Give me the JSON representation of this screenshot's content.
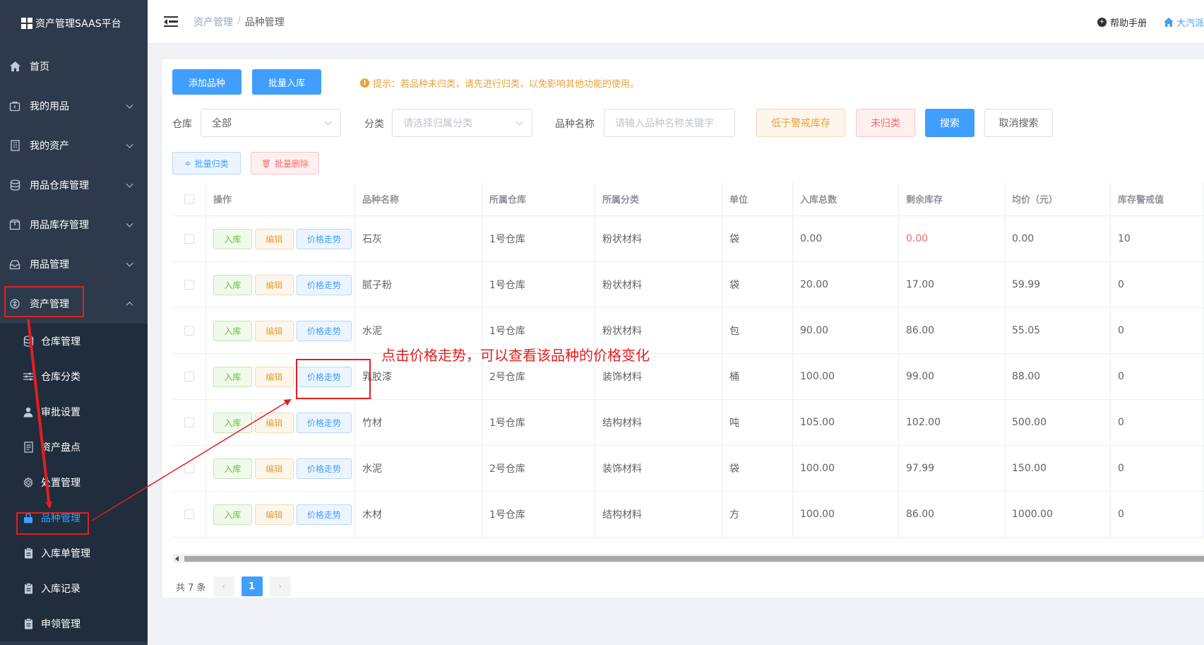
{
  "app": {
    "title": "资产管理SAAS平台"
  },
  "sidebar": {
    "items": [
      {
        "label": "首页",
        "icon": "home-icon"
      },
      {
        "label": "我的用品",
        "icon": "bag-icon"
      },
      {
        "label": "我的资产",
        "icon": "building-icon"
      },
      {
        "label": "用品仓库管理",
        "icon": "database-icon"
      },
      {
        "label": "用品库存管理",
        "icon": "box-icon"
      },
      {
        "label": "用品管理",
        "icon": "inbox-icon"
      },
      {
        "label": "资产管理",
        "icon": "asset-icon"
      }
    ],
    "sub_items": [
      {
        "label": "仓库管理",
        "icon": "database-icon"
      },
      {
        "label": "仓库分类",
        "icon": "sliders-icon"
      },
      {
        "label": "审批设置",
        "icon": "user-icon"
      },
      {
        "label": "资产盘点",
        "icon": "document-icon"
      },
      {
        "label": "处置管理",
        "icon": "gear-icon"
      },
      {
        "label": "品种管理",
        "icon": "lock-icon"
      },
      {
        "label": "入库单管理",
        "icon": "clipboard-icon"
      },
      {
        "label": "入库记录",
        "icon": "clipboard-icon"
      },
      {
        "label": "申领管理",
        "icon": "clipboard-icon"
      }
    ]
  },
  "topbar": {
    "breadcrumb": [
      "资产管理",
      "品种管理"
    ],
    "help": "帮助手册",
    "user": "大汽派"
  },
  "toolbar": {
    "add_label": "添加品种",
    "batch_in_label": "批量入库",
    "tip": "提示：若品种未归类，请先进行归类，以免影响其他功能的使用。",
    "warehouse_label": "仓库",
    "warehouse_value": "全部",
    "category_label": "分类",
    "category_placeholder": "请选择归属分类",
    "name_label": "品种名称",
    "name_placeholder": "请输入品种名称关键字",
    "low_stock_label": "低于警戒库存",
    "unclassified_label": "未归类",
    "search_label": "搜索",
    "cancel_search_label": "取消搜索",
    "batch_classify_label": "批量归类",
    "batch_delete_label": "批量删除"
  },
  "table": {
    "headers": [
      "操作",
      "品种名称",
      "所属仓库",
      "所属分类",
      "单位",
      "入库总数",
      "剩余库存",
      "均价（元）",
      "库存警戒值"
    ],
    "op_labels": {
      "in": "入库",
      "edit": "编辑",
      "price": "价格走势"
    },
    "rows": [
      {
        "name": "石灰",
        "warehouse": "1号仓库",
        "category": "粉状材料",
        "unit": "袋",
        "total": "0.00",
        "remaining": "0.00",
        "avg": "0.00",
        "alert": "10"
      },
      {
        "name": "腻子粉",
        "warehouse": "1号仓库",
        "category": "粉状材料",
        "unit": "袋",
        "total": "20.00",
        "remaining": "17.00",
        "avg": "59.99",
        "alert": "0"
      },
      {
        "name": "水泥",
        "warehouse": "1号仓库",
        "category": "粉状材料",
        "unit": "包",
        "total": "90.00",
        "remaining": "86.00",
        "avg": "55.05",
        "alert": "0"
      },
      {
        "name": "乳胶漆",
        "warehouse": "2号仓库",
        "category": "装饰材料",
        "unit": "桶",
        "total": "100.00",
        "remaining": "99.00",
        "avg": "88.00",
        "alert": "0"
      },
      {
        "name": "竹材",
        "warehouse": "1号仓库",
        "category": "结构材料",
        "unit": "吨",
        "total": "105.00",
        "remaining": "102.00",
        "avg": "500.00",
        "alert": "0"
      },
      {
        "name": "水泥",
        "warehouse": "2号仓库",
        "category": "装饰材料",
        "unit": "袋",
        "total": "100.00",
        "remaining": "97.99",
        "avg": "150.00",
        "alert": "0"
      },
      {
        "name": "木材",
        "warehouse": "1号仓库",
        "category": "结构材料",
        "unit": "方",
        "total": "100.00",
        "remaining": "86.00",
        "avg": "1000.00",
        "alert": "0"
      }
    ]
  },
  "pagination": {
    "total_label": "共 7 条",
    "current_page": "1"
  },
  "annotation": "点击价格走势，可以查看该品种的价格变化",
  "colors": {
    "sidebar_bg": "#2d3a4b",
    "primary": "#409eff",
    "annotation_red": "#e02020"
  }
}
